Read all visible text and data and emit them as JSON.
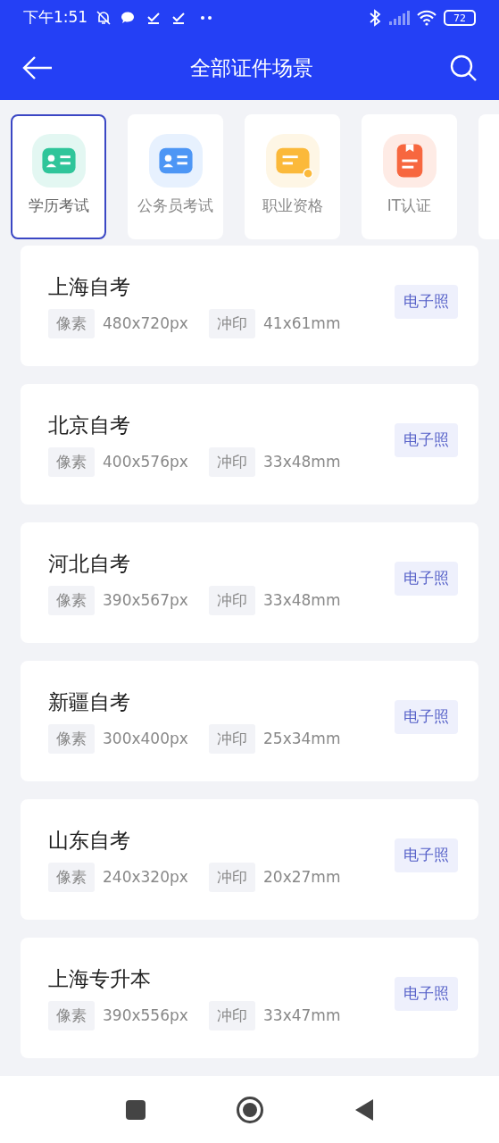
{
  "status_bar": {
    "time": "下午1:51",
    "battery": "72"
  },
  "header": {
    "title": "全部证件场景"
  },
  "categories": [
    {
      "label": "学历考试",
      "selected": true,
      "kind": "id-card",
      "color": "#2fc59a"
    },
    {
      "label": "公务员考试",
      "selected": false,
      "kind": "id-card",
      "color": "#4d96f5"
    },
    {
      "label": "职业资格",
      "selected": false,
      "kind": "certificate",
      "color": "#fbb93a"
    },
    {
      "label": "IT认证",
      "selected": false,
      "kind": "clipboard",
      "color": "#f7673f"
    }
  ],
  "scenes": [
    {
      "title": "上海自考",
      "pixel_label": "像素",
      "pixels": "480x720px",
      "print_label": "冲印",
      "print": "41x61mm",
      "tag": "电子照"
    },
    {
      "title": "北京自考",
      "pixel_label": "像素",
      "pixels": "400x576px",
      "print_label": "冲印",
      "print": "33x48mm",
      "tag": "电子照"
    },
    {
      "title": "河北自考",
      "pixel_label": "像素",
      "pixels": "390x567px",
      "print_label": "冲印",
      "print": "33x48mm",
      "tag": "电子照"
    },
    {
      "title": "新疆自考",
      "pixel_label": "像素",
      "pixels": "300x400px",
      "print_label": "冲印",
      "print": "25x34mm",
      "tag": "电子照"
    },
    {
      "title": "山东自考",
      "pixel_label": "像素",
      "pixels": "240x320px",
      "print_label": "冲印",
      "print": "20x27mm",
      "tag": "电子照"
    },
    {
      "title": "上海专升本",
      "pixel_label": "像素",
      "pixels": "390x556px",
      "print_label": "冲印",
      "print": "33x47mm",
      "tag": "电子照"
    }
  ]
}
